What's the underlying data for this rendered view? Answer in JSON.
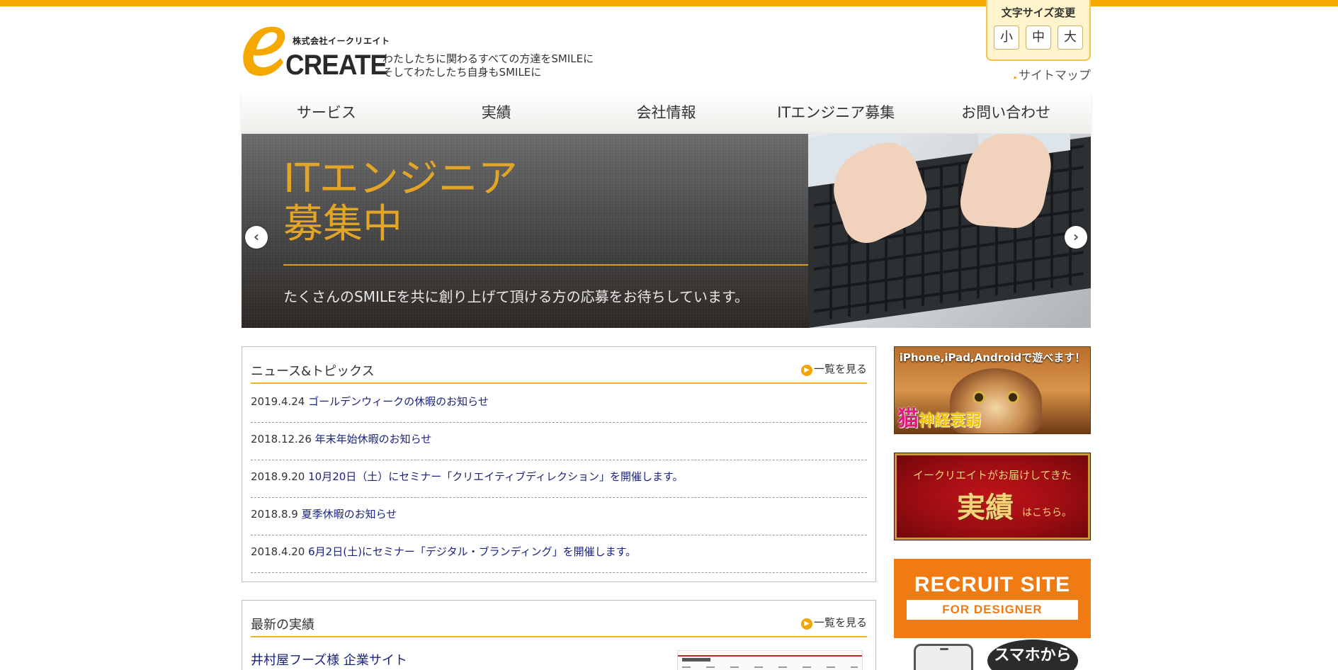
{
  "company": {
    "corp_name": "株式会社イークリエイト",
    "logo_word": "CREATE",
    "tagline_1": "わたしたちに関わるすべての方達をSMILEに",
    "tagline_2": "そしてわたしたち自身もSMILEに"
  },
  "font_size": {
    "title": "文字サイズ変更",
    "small": "小",
    "medium": "中",
    "large": "大"
  },
  "sitemap_label": "サイトマップ",
  "nav": {
    "items": [
      {
        "label": "サービス"
      },
      {
        "label": "実績"
      },
      {
        "label": "会社情報"
      },
      {
        "label": "ITエンジニア募集"
      },
      {
        "label": "お問い合わせ"
      }
    ]
  },
  "hero": {
    "title_1": "ITエンジニア",
    "title_2": "募集中",
    "subtitle": "たくさんのSMILEを共に創り上げて頂ける方の応募をお待ちしています。"
  },
  "news": {
    "title": "ニュース&トピックス",
    "more_label": "一覧を見る",
    "items": [
      {
        "date": "2019.4.24",
        "text": "ゴールデンウィークの休暇のお知らせ"
      },
      {
        "date": "2018.12.26",
        "text": "年末年始休暇のお知らせ"
      },
      {
        "date": "2018.9.20",
        "text": "10月20日（土）にセミナー「クリエイティブディレクション」を開催します。"
      },
      {
        "date": "2018.8.9",
        "text": "夏季休暇のお知らせ"
      },
      {
        "date": "2018.4.20",
        "text": "6月2日(土)にセミナー「デジタル・ブランディング」を開催します。"
      }
    ]
  },
  "works": {
    "title": "最新の実績",
    "more_label": "一覧を見る",
    "latest": "井村屋フーズ様 企業サイト"
  },
  "banners": {
    "game": {
      "caption": "iPhone,iPad,Androidで遊べます！",
      "title_main": "猫",
      "title_rest": "神経衰弱"
    },
    "works": {
      "top": "イークリエイトがお届けしてきた",
      "main": "実績",
      "small": "はこちら。"
    },
    "recruit": {
      "title": "RECRUIT SITE",
      "band": "FOR DESIGNER",
      "bubble": "スマホから"
    }
  },
  "colors": {
    "accent": "#f7a800",
    "link": "#1a237e",
    "hero_gold": "#e3a526",
    "recruit_orange": "#f07b12",
    "works_red": "#9b0d12"
  }
}
